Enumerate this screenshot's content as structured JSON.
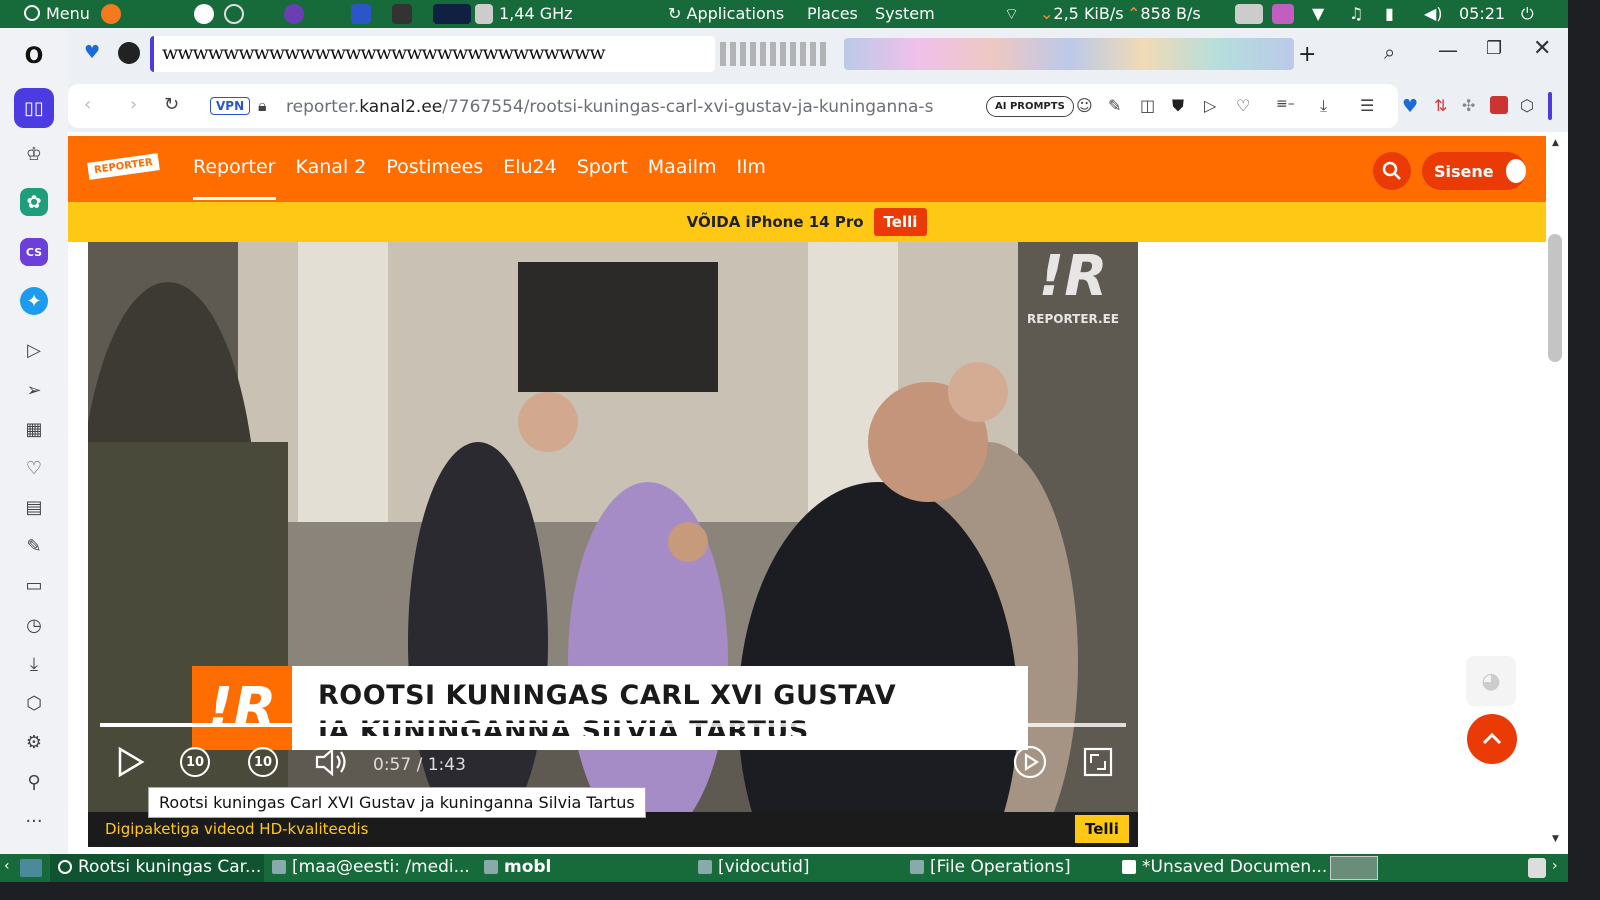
{
  "system_panel": {
    "menu_label": "Menu",
    "cpu_freq": "1,44 GHz",
    "applications": "Applications",
    "places": "Places",
    "system": "System",
    "net_down": "2,5 KiB/s",
    "net_up": "858 B/s",
    "clock": "05:21"
  },
  "browser": {
    "tab_strip_text": "wwwwwwwwwwwwwwwwwwwwwwwwwwwww",
    "vpn_label": "VPN",
    "url_prefix": "reporter.",
    "url_domain": "kanal2.ee",
    "url_path": "/7767554/rootsi-kuningas-carl-xvi-gustav-ja-kuninganna-s",
    "ai_prompts_label": "AI PROMPTS"
  },
  "site": {
    "logo_text": "REPORTER",
    "nav": [
      {
        "label": "Reporter"
      },
      {
        "label": "Kanal 2"
      },
      {
        "label": "Postimees"
      },
      {
        "label": "Elu24"
      },
      {
        "label": "Sport"
      },
      {
        "label": "Maailm"
      },
      {
        "label": "Ilm"
      }
    ],
    "login_label": "Sisene",
    "promo_text": "VÕIDA iPhone 14 Pro",
    "promo_button": "Telli"
  },
  "video": {
    "watermark_text": "REPORTER.EE",
    "caption_line1": "ROOTSI KUNINGAS CARL XVI GUSTAV",
    "caption_line2": "JA KUNINGANNA SILVIA TARTUS",
    "time": "0:57 / 1:43",
    "progress_fraction": 0.553,
    "tooltip": "Rootsi kuningas Carl XVI Gustav ja kuninganna Silvia Tartus",
    "bottom_text": "Digipaketiga videod HD-kvaliteedis",
    "bottom_button": "Telli",
    "skip_seconds": "10"
  },
  "taskbar": {
    "items": [
      {
        "label": "Rootsi kuningas Car..."
      },
      {
        "label": "[maa@eesti: /medi..."
      },
      {
        "label": "mobl"
      },
      {
        "label": "[vidocutid]"
      },
      {
        "label": "[File Operations]"
      },
      {
        "label": "*Unsaved Documen..."
      }
    ]
  },
  "colors": {
    "accent_orange": "#ff6c00",
    "accent_red": "#ea3b07",
    "promo_yellow": "#ffc815",
    "panel_green": "#176a3a"
  }
}
